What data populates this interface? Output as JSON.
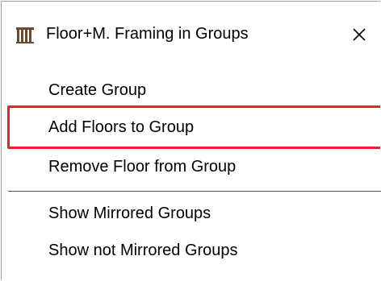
{
  "window": {
    "title": "Floor+M. Framing in Groups",
    "icon": "floor-framing-icon",
    "close_glyph": "✕"
  },
  "menu": {
    "items": [
      {
        "label": "Create Group"
      },
      {
        "label": "Add Floors to Group",
        "highlighted": true
      },
      {
        "label": "Remove Floor from Group"
      },
      {
        "label": "Show Mirrored Groups"
      },
      {
        "label": "Show not Mirrored Groups"
      }
    ]
  },
  "colors": {
    "highlight_border": "#e8242a",
    "icon": "#6b4a2f"
  }
}
